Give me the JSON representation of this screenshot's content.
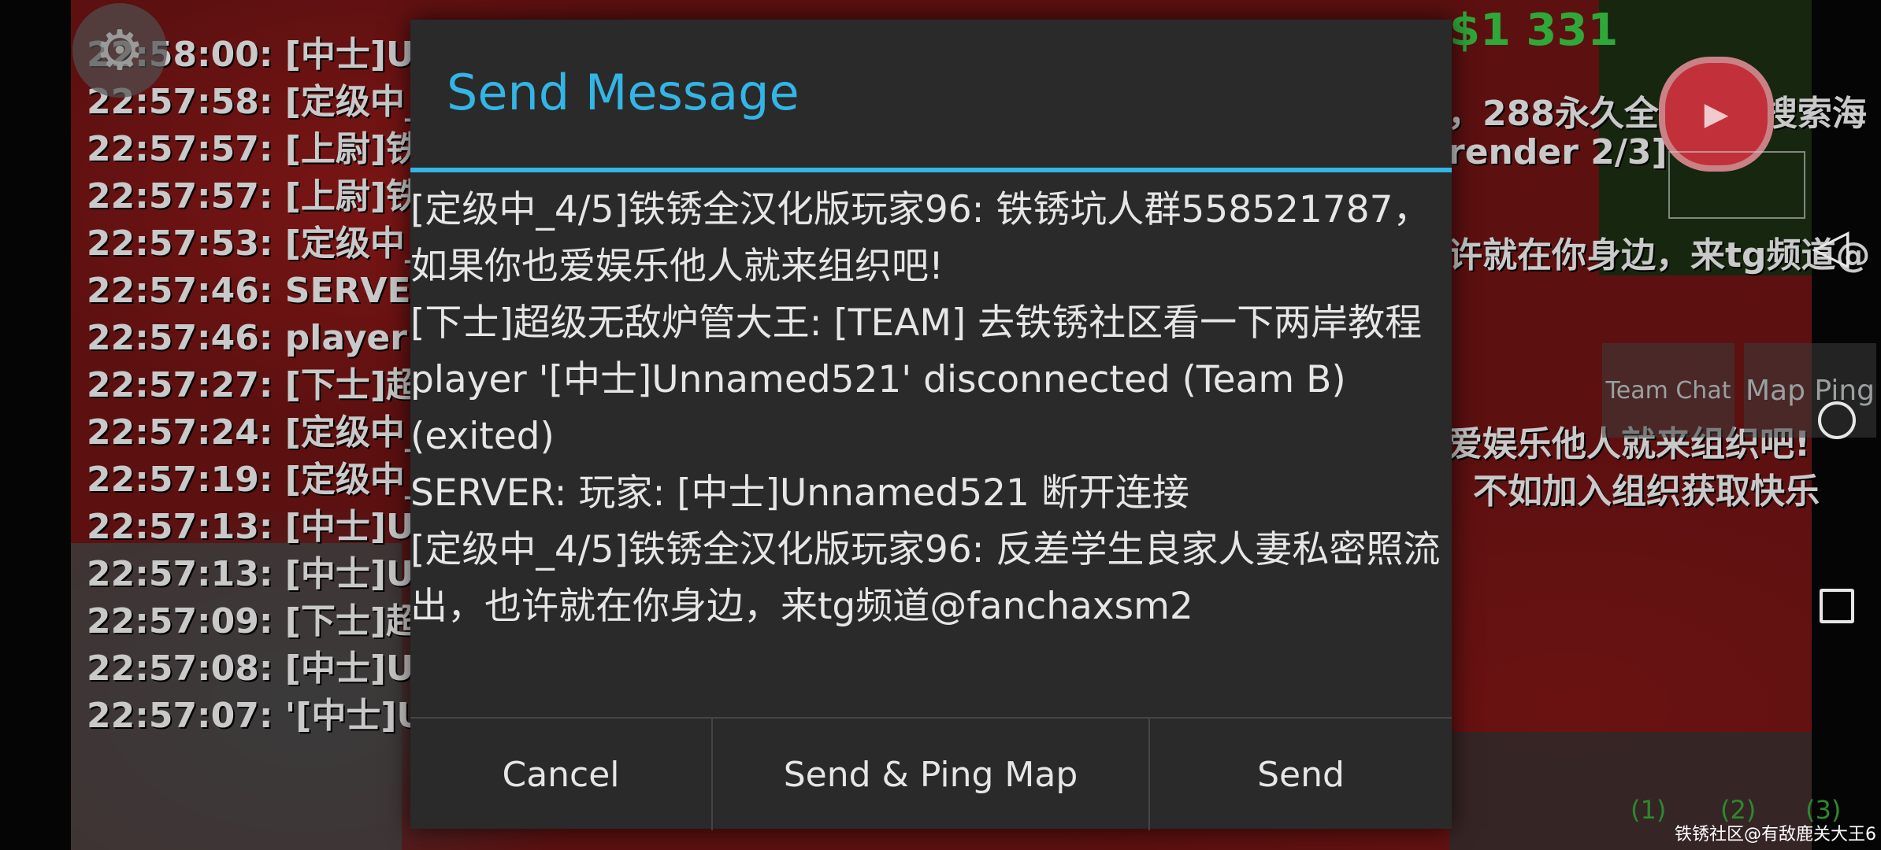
{
  "game": {
    "money": "$1 331",
    "chat_log": [
      "22:58:00: [中士]U",
      "22:57:58: [定级中_",
      "22:57:57: [上尉]铁",
      "22:57:57: [上尉]铁",
      "22:57:53: [定级中_",
      "22:57:46: SERVER",
      "22:57:46: player '",
      "22:57:27: [下士]超",
      "22:57:24: [定级中_",
      "22:57:19: [定级中_",
      "22:57:13: [中士]U",
      "22:57:13: [中士]U",
      "22:57:09: [下士]超",
      "22:57:08: [中士]U",
      "22:57:07: '[中士]U"
    ],
    "chat_right": [
      "，288永久全解锁，搜索海",
      "render 2/3]",
      "许就在你身边，来tg频道@",
      "爱娱乐他人就来组织吧!",
      "不如加入组织获取快乐"
    ],
    "buttons": {
      "team_chat": "Team Chat",
      "map_ping": "Map Ping"
    },
    "unit_groups": [
      "(1)",
      "(2)",
      "(3)"
    ],
    "watermark": "铁锈社区@有敌鹿关大王6"
  },
  "dialog": {
    "title": "Send Message",
    "messages": [
      "[定级中_4/5]铁锈全汉化版玩家96: 铁锈坑人群558521787，如果你也爱娱乐他人就来组织吧!",
      "[下士]超级无敌炉管大王: [TEAM]  去铁锈社区看一下两岸教程",
      "player '[中士]Unnamed521' disconnected (Team B) (exited)",
      "SERVER: 玩家: [中士]Unnamed521 断开连接",
      "[定级中_4/5]铁锈全汉化版玩家96: 反差学生良家人妻私密照流出，也许就在你身边，来tg频道@fanchaxsm2"
    ],
    "buttons": {
      "cancel": "Cancel",
      "send_ping": "Send & Ping Map",
      "send": "Send"
    }
  },
  "colors": {
    "accent": "#33b5e5",
    "dialog_bg": "#2a2a2a",
    "money": "#2fa83a"
  }
}
